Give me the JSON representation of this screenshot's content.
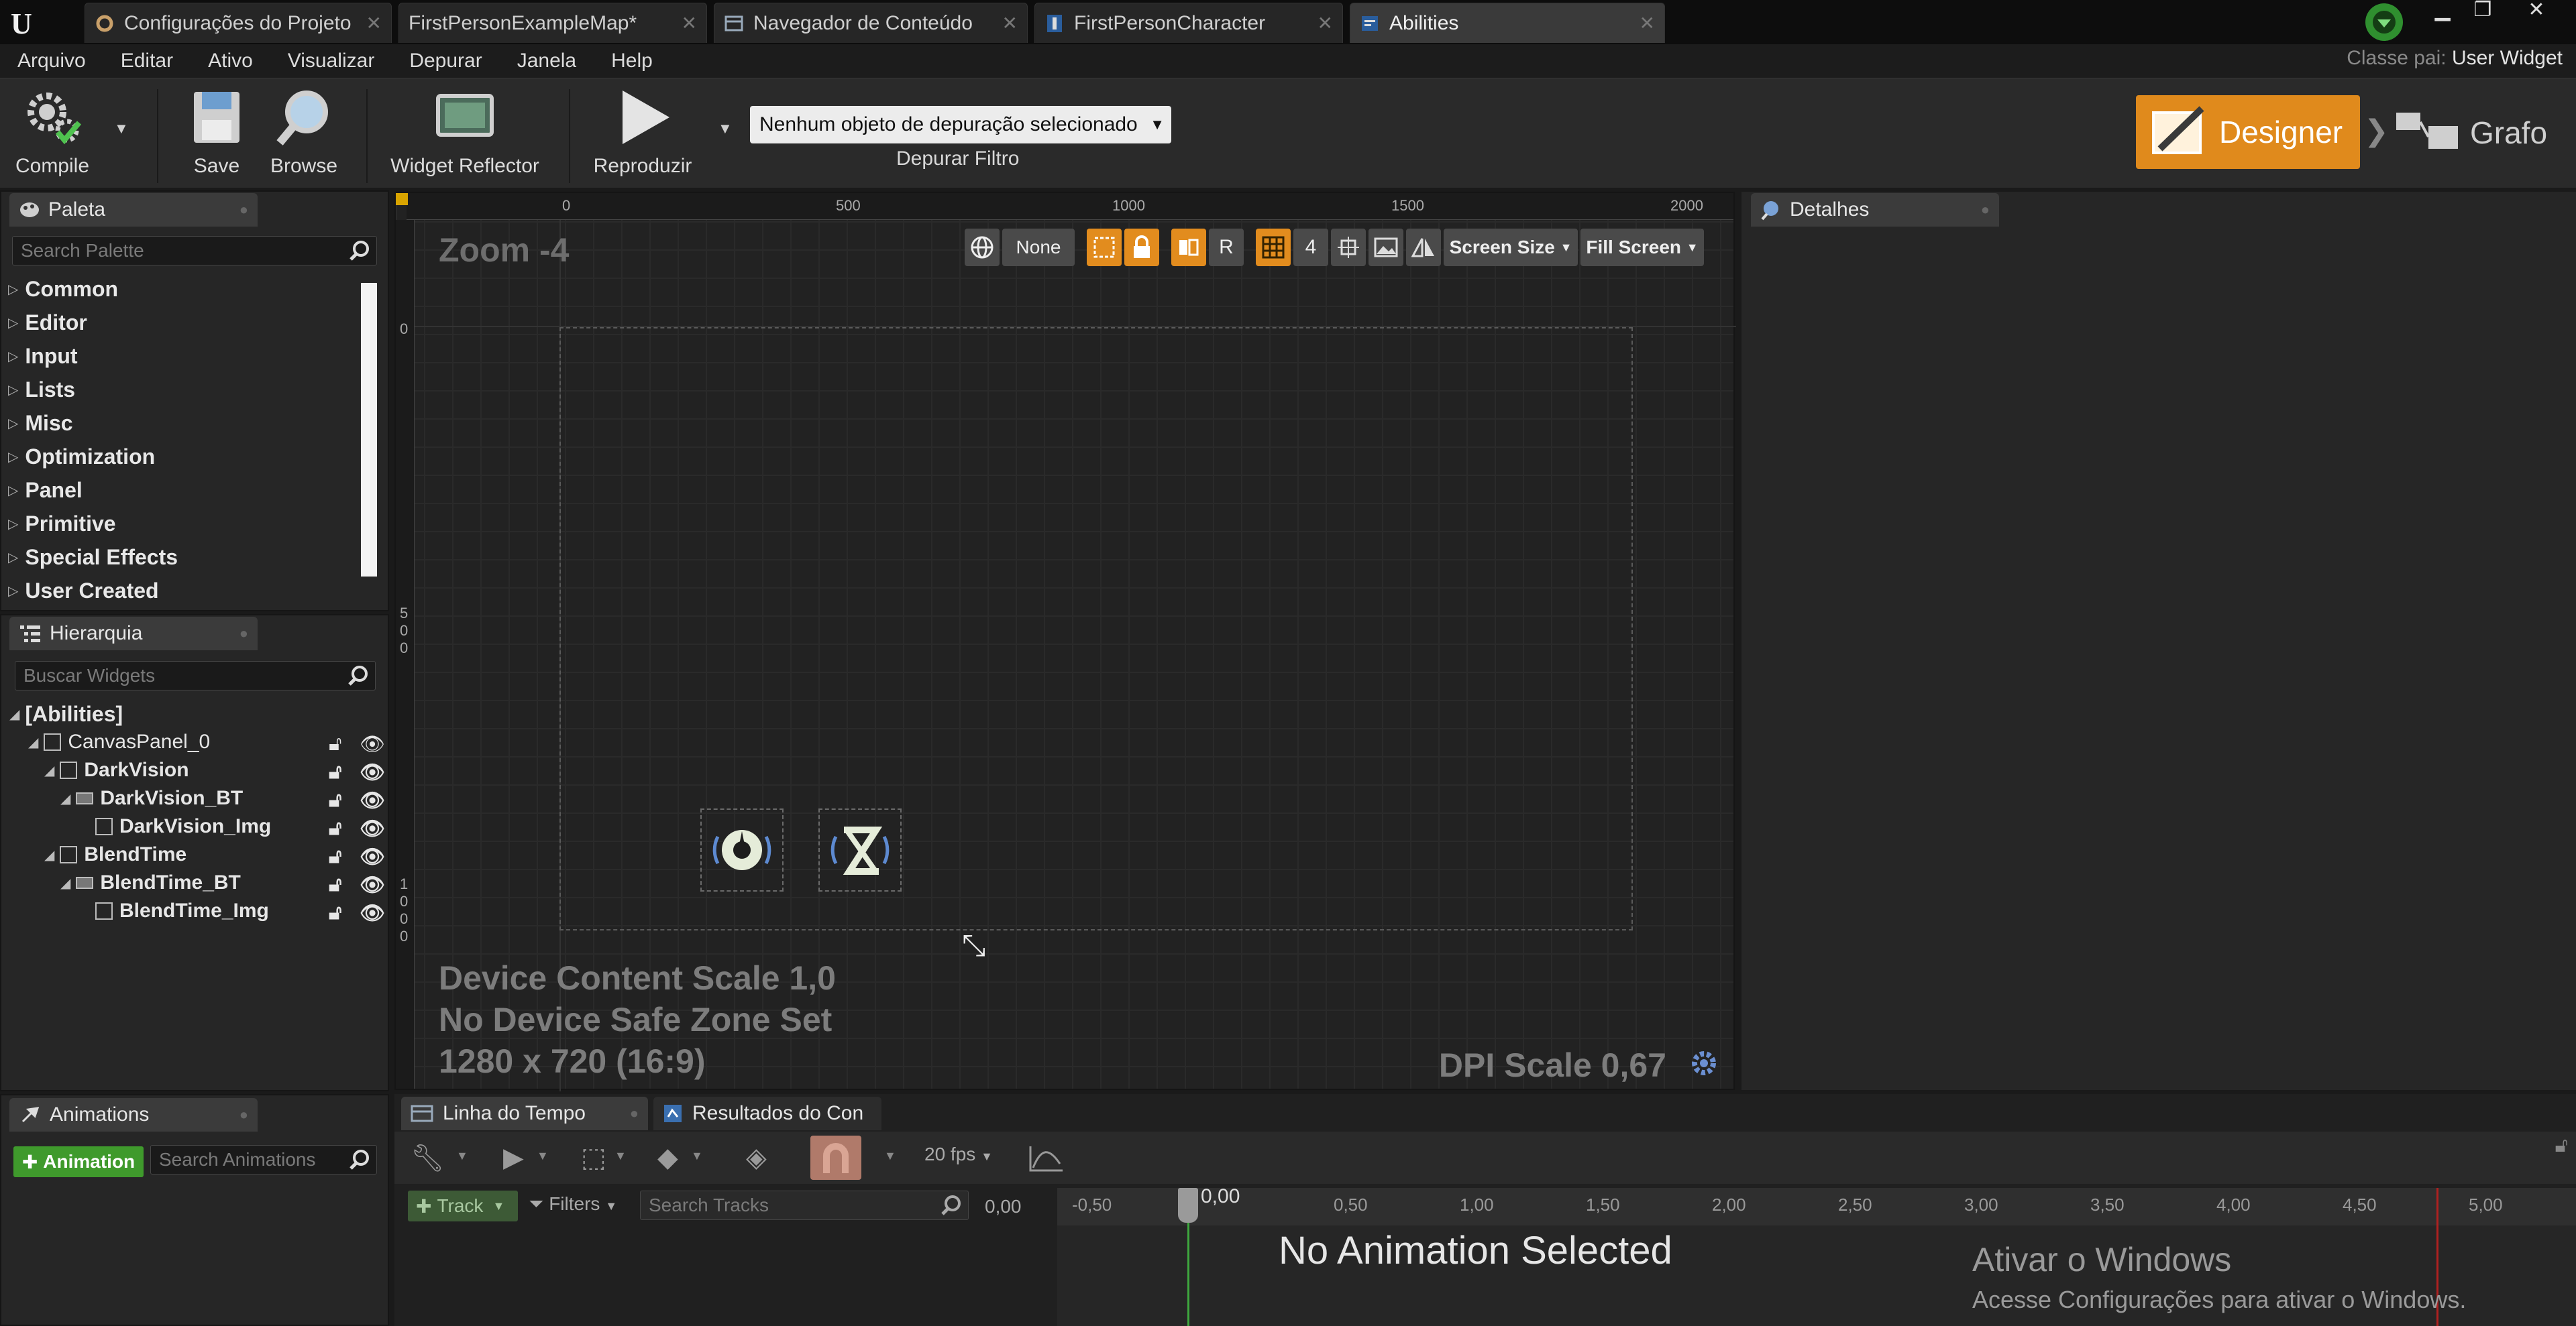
{
  "tabs": [
    {
      "label": "Configurações do Projeto",
      "icon": "settings-gear-icon",
      "active": false
    },
    {
      "label": "FirstPersonExampleMap*",
      "icon": "level-map-icon",
      "active": false
    },
    {
      "label": "Navegador de Conteúdo",
      "icon": "content-browser-icon",
      "active": false
    },
    {
      "label": "FirstPersonCharacter",
      "icon": "blueprint-character-icon",
      "active": false
    },
    {
      "label": "Abilities",
      "icon": "widget-blueprint-icon",
      "active": true
    }
  ],
  "menu": [
    "Arquivo",
    "Editar",
    "Ativo",
    "Visualizar",
    "Depurar",
    "Janela",
    "Help"
  ],
  "parent_class": {
    "label": "Classe pai:",
    "value": "User Widget"
  },
  "toolbar": {
    "compile": "Compile",
    "save": "Save",
    "browse": "Browse",
    "widget_reflector": "Widget Reflector",
    "play": "Reproduzir",
    "debug_selected": "Nenhum objeto de depuração selecionado",
    "debug_filter": "Depurar Filtro",
    "designer": "Designer",
    "graph": "Grafo"
  },
  "palette": {
    "tab": "Paleta",
    "search_placeholder": "Search Palette",
    "categories": [
      "Common",
      "Editor",
      "Input",
      "Lists",
      "Misc",
      "Optimization",
      "Panel",
      "Primitive",
      "Special Effects",
      "User Created"
    ]
  },
  "hierarchy": {
    "tab": "Hierarquia",
    "search_placeholder": "Buscar Widgets",
    "root": "[Abilities]",
    "items": [
      {
        "label": "CanvasPanel_0",
        "bold": false
      },
      {
        "label": "DarkVision",
        "bold": true
      },
      {
        "label": "DarkVision_BT",
        "bold": true
      },
      {
        "label": "DarkVision_Img",
        "bold": true
      },
      {
        "label": "BlendTime",
        "bold": true
      },
      {
        "label": "BlendTime_BT",
        "bold": true
      },
      {
        "label": "BlendTime_Img",
        "bold": true
      }
    ]
  },
  "designer": {
    "zoom": "Zoom -4",
    "ruler_top": [
      "0",
      "500",
      "1000",
      "1500",
      "2000"
    ],
    "ruler_left": [
      "0",
      "5\n0\n0",
      "1\n0\n0\n0"
    ],
    "none_label": "None",
    "r_label": "R",
    "grid_snap": "4",
    "screen_size": "Screen Size",
    "fill_screen": "Fill Screen",
    "device_scale": "Device Content Scale 1,0",
    "safe_zone": "No Device Safe Zone Set",
    "resolution": "1280 x 720 (16:9)",
    "dpi_scale": "DPI Scale 0,67"
  },
  "details": {
    "tab": "Detalhes"
  },
  "animations": {
    "tab": "Animations",
    "add": "Animation",
    "search_placeholder": "Search Animations"
  },
  "timeline": {
    "tab_timeline": "Linha do Tempo",
    "tab_results": "Resultados do Con",
    "fps": "20 fps",
    "track": "Track",
    "filters": "Filters",
    "search_tracks": "Search Tracks",
    "time_value": "0,00",
    "playhead": "0,00",
    "ticks": [
      "-0,50",
      "0,50",
      "1,00",
      "1,50",
      "2,00",
      "2,50",
      "3,00",
      "3,50",
      "4,00",
      "4,50",
      "5,00"
    ],
    "no_animation": "No Animation Selected"
  },
  "watermark": {
    "title": "Ativar o Windows",
    "subtitle": "Acesse Configurações para ativar o Windows."
  },
  "colors": {
    "accent": "#e08a1c",
    "add_button": "#3f9a2c",
    "panel_bg": "#262626"
  }
}
